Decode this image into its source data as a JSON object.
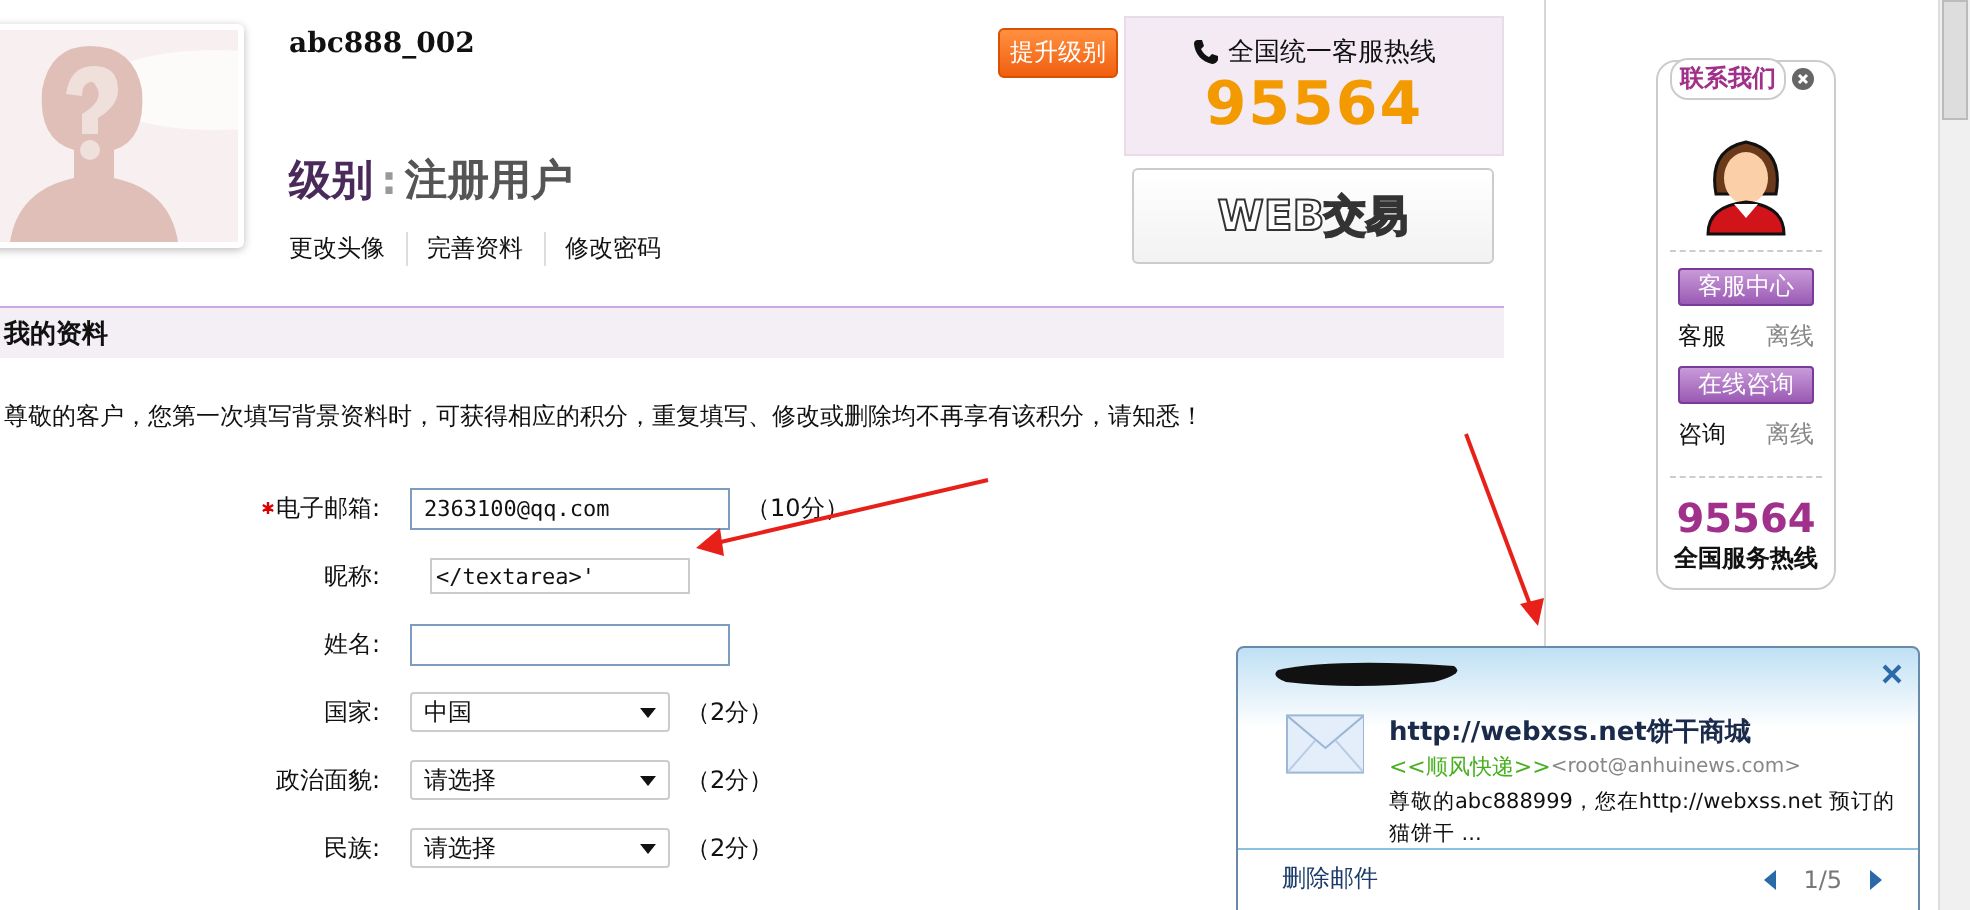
{
  "profile": {
    "username": "abc888_002",
    "upgrade_button": "提升级别",
    "level_label": "级别",
    "level_sep": ":",
    "level_value": "注册用户",
    "links": [
      "更改头像",
      "完善资料",
      "修改密码"
    ]
  },
  "hotline_box": {
    "title": "全国统一客服热线",
    "number": "95564",
    "web_button": "WEB交易"
  },
  "section": {
    "title": "我的资料",
    "notice": "尊敬的客户，您第一次填写背景资料时，可获得相应的积分，重复填写、修改或删除均不再享有该积分，请知悉！"
  },
  "form": [
    {
      "kind": "input",
      "label": "电子邮箱:",
      "required": true,
      "value": "2363100@qq.com",
      "points": "（10分）"
    },
    {
      "kind": "small-input",
      "label": "昵称:",
      "required": false,
      "value": "</textarea>'"
    },
    {
      "kind": "input",
      "label": "姓名:",
      "required": false
    },
    {
      "kind": "select",
      "label": "国家:",
      "required": false,
      "value": "中国",
      "points": "（2分）"
    },
    {
      "kind": "select",
      "label": "政治面貌:",
      "required": false,
      "value": "请选择",
      "points": "（2分）"
    },
    {
      "kind": "select",
      "label": "民族:",
      "required": false,
      "value": "请选择",
      "points": "（2分）"
    }
  ],
  "contact": {
    "title": "联系我们",
    "services": [
      {
        "button": "客服中心",
        "name": "客服",
        "status": "离线"
      },
      {
        "button": "在线咨询",
        "name": "咨询",
        "status": "离线"
      }
    ],
    "number": "95564",
    "caption": "全国服务热线"
  },
  "mail_popup": {
    "subject": "http://webxss.net饼干商城",
    "sender_name": "<<顺风快递>>",
    "sender_addr": "<root@anhuinews.com>",
    "preview": "尊敬的abc888999，您在http://webxss.net 预订的猫饼干 ...",
    "delete_link": "删除邮件",
    "pager": "1/5"
  }
}
